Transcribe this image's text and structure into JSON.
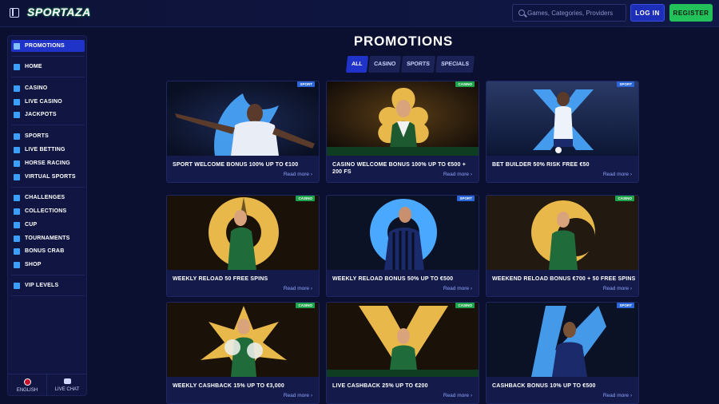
{
  "header": {
    "logo_text": "SPORTAZA",
    "search_placeholder": "Games, Categories, Providers",
    "login_label": "LOG IN",
    "register_label": "REGISTER"
  },
  "sidebar": {
    "items": [
      {
        "label": "PROMOTIONS",
        "icon": "gift-icon",
        "active": true
      },
      {
        "label": "HOME",
        "icon": "home-icon"
      },
      {
        "label": "CASINO",
        "icon": "casino-icon"
      },
      {
        "label": "LIVE CASINO",
        "icon": "live-casino-icon"
      },
      {
        "label": "JACKPOTS",
        "icon": "jackpot-icon"
      },
      {
        "label": "SPORTS",
        "icon": "sports-icon"
      },
      {
        "label": "LIVE BETTING",
        "icon": "live-betting-icon"
      },
      {
        "label": "HORSE RACING",
        "icon": "horse-icon"
      },
      {
        "label": "VIRTUAL SPORTS",
        "icon": "virtual-sports-icon"
      },
      {
        "label": "CHALLENGES",
        "icon": "challenges-icon"
      },
      {
        "label": "COLLECTIONS",
        "icon": "collections-icon"
      },
      {
        "label": "CUP",
        "icon": "cup-icon"
      },
      {
        "label": "TOURNAMENTS",
        "icon": "tournaments-icon"
      },
      {
        "label": "BONUS CRAB",
        "icon": "crab-icon"
      },
      {
        "label": "SHOP",
        "icon": "shop-icon"
      },
      {
        "label": "VIP LEVELS",
        "icon": "diamond-icon"
      }
    ],
    "language_label": "ENGLISH",
    "live_chat_label": "LIVE CHAT"
  },
  "main": {
    "title": "PROMOTIONS",
    "tabs": [
      {
        "label": "ALL",
        "active": true
      },
      {
        "label": "CASINO"
      },
      {
        "label": "SPORTS"
      },
      {
        "label": "SPECIALS"
      }
    ],
    "read_more_label": "Read more",
    "cards": [
      {
        "title": "SPORT WELCOME BONUS 100% UP TO €100",
        "badge": "SPORT",
        "badge_type": "sport"
      },
      {
        "title": "CASINO WELCOME BONUS 100% UP TO €500 + 200 FS",
        "badge": "CASINO",
        "badge_type": "casino"
      },
      {
        "title": "BET BUILDER 50% RISK FREE €50",
        "badge": "SPORT",
        "badge_type": "sport"
      },
      {
        "title": "WEEKLY RELOAD 50 FREE SPINS",
        "badge": "CASINO",
        "badge_type": "casino"
      },
      {
        "title": "WEEKLY RELOAD BONUS 50% UP TO €500",
        "badge": "SPORT",
        "badge_type": "sport"
      },
      {
        "title": "WEEKEND RELOAD BONUS €700 + 50 FREE SPINS",
        "badge": "CASINO",
        "badge_type": "casino"
      },
      {
        "title": "WEEKLY CASHBACK 15% UP TO €3,000",
        "badge": "CASINO",
        "badge_type": "casino"
      },
      {
        "title": "LIVE CASHBACK 25% UP TO €200",
        "badge": "CASINO",
        "badge_type": "casino"
      },
      {
        "title": "CASHBACK BONUS 10% UP TO €500",
        "badge": "SPORT",
        "badge_type": "sport"
      }
    ]
  },
  "colors": {
    "background": "#0b1030",
    "accent_blue": "#1f33c9",
    "accent_green": "#23c15a",
    "gold": "#e8b84a",
    "sport_blue": "#4aa8ff"
  }
}
